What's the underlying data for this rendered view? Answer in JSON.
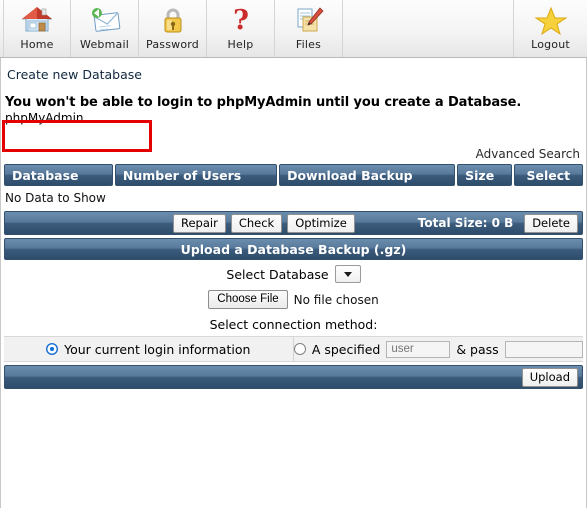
{
  "toolbar": {
    "items": [
      {
        "label": "Home",
        "icon": "house-icon"
      },
      {
        "label": "Webmail",
        "icon": "envelope-icon"
      },
      {
        "label": "Password",
        "icon": "padlock-icon"
      },
      {
        "label": "Help",
        "icon": "question-mark-icon"
      },
      {
        "label": "Files",
        "icon": "documents-pencil-icon"
      }
    ],
    "logout": {
      "label": "Logout",
      "icon": "star-icon"
    }
  },
  "breadcrumb": {
    "create_new_database": "Create new Database"
  },
  "notice": {
    "warning": "You won't be able to login to phpMyAdmin until you create a Database.",
    "link": "phpMyAdmin"
  },
  "search": {
    "advanced": "Advanced Search"
  },
  "table": {
    "columns": [
      "Database",
      "Number of Users",
      "Download Backup",
      "Size",
      "Select"
    ],
    "empty_message": "No Data to Show"
  },
  "actions": {
    "repair": "Repair",
    "check": "Check",
    "optimize": "Optimize",
    "total_size": "Total Size: 0 B",
    "delete": "Delete"
  },
  "upload": {
    "section_title": "Upload a Database Backup (.gz)",
    "select_database_label": "Select Database",
    "select_database_value": "",
    "choose_file_button": "Choose File",
    "file_status": "No file chosen",
    "connection_method_label": "Select connection method:",
    "option_current": "Your current login information",
    "option_specified": "A specified",
    "user_placeholder": "user",
    "user_value": "",
    "and_pass_label": "& pass",
    "pass_placeholder": "",
    "pass_value": "",
    "upload_button": "Upload"
  },
  "colors": {
    "header_blue": "#3c5c7d",
    "annotation_red": "#e50000",
    "link_dark": "#11283f"
  }
}
